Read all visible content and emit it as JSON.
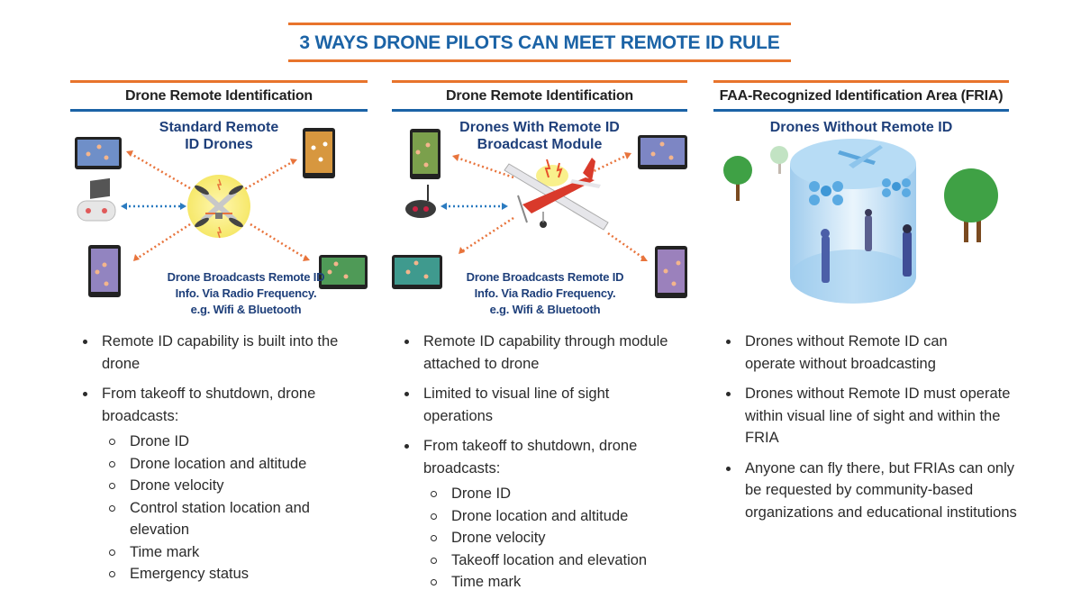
{
  "title": "3 WAYS DRONE PILOTS CAN MEET REMOTE ID RULE",
  "colors": {
    "accent_orange": "#e8742c",
    "accent_blue": "#1b63a6",
    "subtitle_navy": "#1e3f7a",
    "signal_dots_orange": "#e8743c",
    "signal_dots_blue": "#2b7bc0"
  },
  "columns": [
    {
      "header": "Drone Remote Identification",
      "subtitle": "Standard Remote ID Drones",
      "subtitle_lines": [
        "Standard Remote",
        "ID Drones"
      ],
      "caption_lines": [
        "Drone Broadcasts Remote ID",
        "Info. Via Radio Frequency.",
        "e.g. Wifi & Bluetooth"
      ],
      "illustration": {
        "center": "quadcopter-drone-icon",
        "devices": [
          "tablet-icon",
          "tablet-icon",
          "tablet-icon",
          "tablet-icon"
        ],
        "controller": "controller-with-screen-icon"
      },
      "bullets": [
        {
          "text": "Remote ID capability is built into the drone",
          "sub": []
        },
        {
          "text": "From takeoff to shutdown, drone broadcasts:",
          "sub": [
            "Drone ID",
            "Drone location and altitude",
            "Drone velocity",
            "Control station location and elevation",
            "Time mark",
            "Emergency status"
          ]
        }
      ]
    },
    {
      "header": "Drone Remote Identification",
      "subtitle": "Drones With Remote ID Broadcast Module",
      "subtitle_lines": [
        "Drones With Remote ID",
        "Broadcast Module"
      ],
      "caption_lines": [
        "Drone Broadcasts Remote ID",
        "Info. Via Radio Frequency.",
        "e.g. Wifi & Bluetooth"
      ],
      "illustration": {
        "center": "fixed-wing-airplane-icon",
        "devices": [
          "tablet-icon",
          "tablet-icon",
          "tablet-icon",
          "tablet-icon"
        ],
        "controller": "gamepad-controller-icon"
      },
      "bullets": [
        {
          "text": "Remote ID capability through module attached to drone",
          "sub": []
        },
        {
          "text": "Limited to visual line of sight operations",
          "sub": []
        },
        {
          "text": "From takeoff to shutdown, drone broadcasts:",
          "sub": [
            "Drone ID",
            "Drone location and altitude",
            "Drone velocity",
            "Takeoff location and elevation",
            "Time mark"
          ]
        }
      ]
    },
    {
      "header": "FAA-Recognized Identification Area (FRIA)",
      "subtitle": "Drones Without Remote ID",
      "subtitle_lines": [
        "Drones Without Remote ID"
      ],
      "illustration": {
        "center": "fria-cylinder-area-icon",
        "elements": [
          "tree-icon",
          "tree-icon",
          "tree-icon",
          "airplane-icon",
          "quadcopter-icon",
          "quadcopter-icon",
          "person-icon",
          "person-icon",
          "person-icon"
        ]
      },
      "bullets": [
        {
          "text": "Drones without Remote ID can operate without broadcasting",
          "sub": []
        },
        {
          "text": "Drones without Remote ID must operate within visual line of sight and within the FRIA",
          "sub": []
        },
        {
          "text": "Anyone can fly there, but FRIAs can only be requested by community-based organizations and educational institutions",
          "sub": []
        }
      ]
    }
  ]
}
